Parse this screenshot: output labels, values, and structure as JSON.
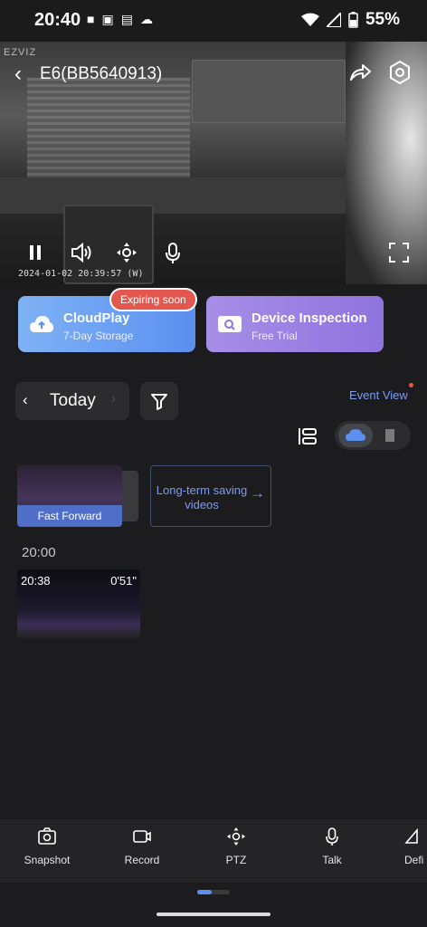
{
  "status": {
    "time": "20:40",
    "battery": "55%"
  },
  "camera": {
    "brand": "EZVIZ",
    "title": "E6(BB5640913)",
    "timestamp": "2024-01-02 20:39:57 (W)"
  },
  "cards": {
    "badge": "Expiring soon",
    "cloud": {
      "title": "CloudPlay",
      "subtitle": "7-Day Storage"
    },
    "inspection": {
      "title": "Device Inspection",
      "subtitle": "Free Trial"
    }
  },
  "date_nav": {
    "prev": "‹",
    "label": "Today",
    "next": "›"
  },
  "event_view": "Event View",
  "fast_forward": "Fast Forward",
  "long_term": {
    "text": "Long-term saving videos",
    "arrow": "→"
  },
  "timeline": {
    "hour": "20:00",
    "clip_time": "20:38",
    "clip_duration": "0'51\""
  },
  "toolbar": {
    "snapshot": "Snapshot",
    "record": "Record",
    "ptz": "PTZ",
    "talk": "Talk",
    "definition": "Defi"
  },
  "colors": {
    "accent": "#5b8ff0",
    "link": "#7b9cf5",
    "badge": "#e4574f",
    "bg": "#1c1c1e"
  },
  "icons": [
    "back-icon",
    "share-icon",
    "settings-icon",
    "pause-icon",
    "volume-icon",
    "ptz-icon",
    "microphone-icon",
    "fullscreen-icon",
    "cloud-upload-icon",
    "inspection-icon",
    "filter-icon",
    "list-icon",
    "cloud-icon",
    "sd-card-icon",
    "camera-icon",
    "record-icon"
  ]
}
